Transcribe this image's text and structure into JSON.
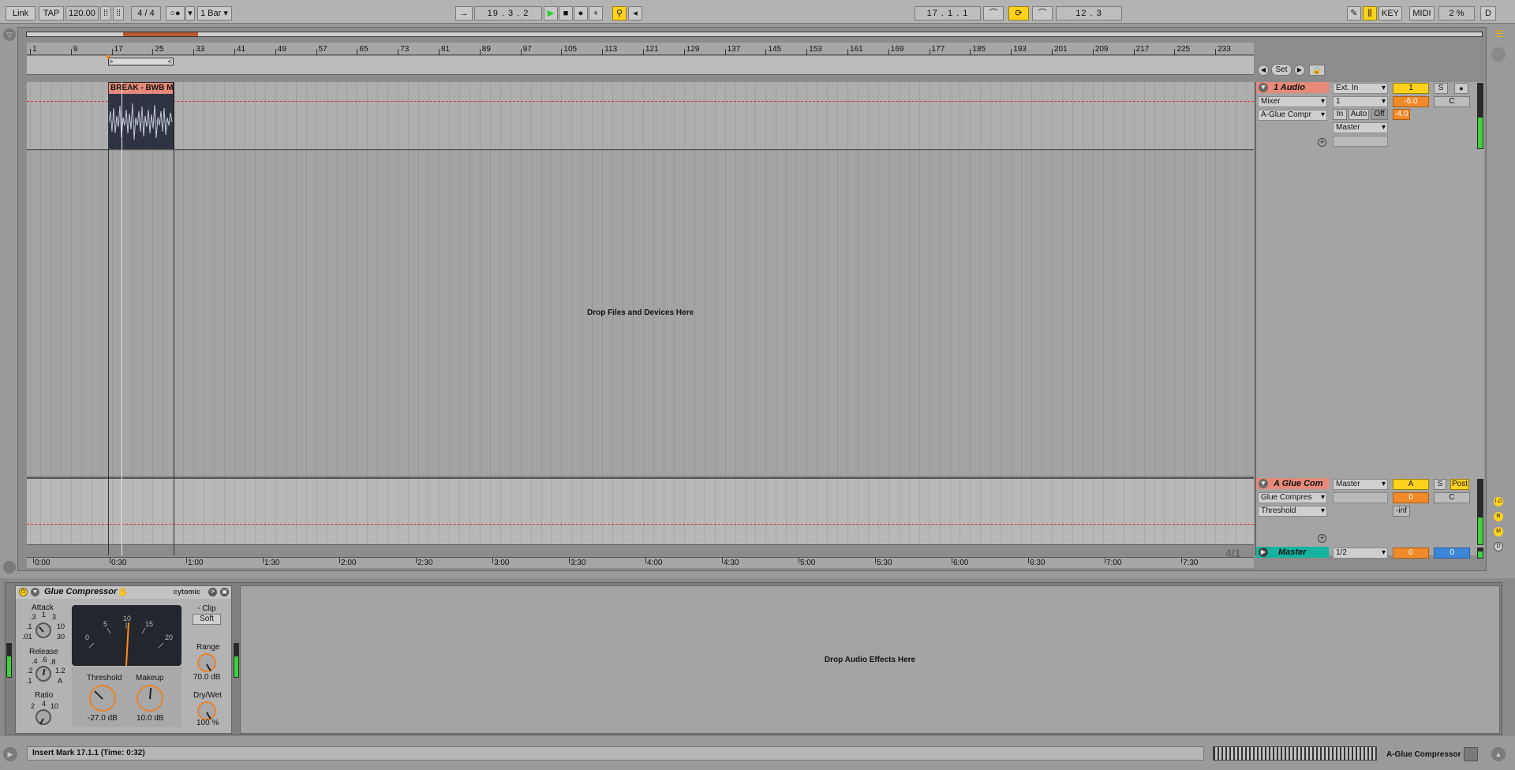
{
  "transport": {
    "link": "Link",
    "tap": "TAP",
    "tempo": "120.00",
    "time_sig": "4 / 4",
    "quantize": "1 Bar",
    "position": [
      "19",
      "3",
      "2"
    ],
    "loop_start": [
      "17",
      "1",
      "1"
    ],
    "loop_length": [
      "12",
      "3",
      ""
    ],
    "key": "KEY",
    "midi": "MIDI",
    "cpu": "2 %",
    "d": "D"
  },
  "ruler": {
    "bars": [
      "1",
      "9",
      "17",
      "25",
      "33",
      "41",
      "49",
      "57",
      "65",
      "73",
      "81",
      "89",
      "97",
      "105",
      "113",
      "121",
      "129",
      "137",
      "145",
      "153",
      "161",
      "169",
      "177",
      "185",
      "193",
      "201",
      "209",
      "217",
      "225",
      "233"
    ],
    "times": [
      "0:00",
      "0:30",
      "1:00",
      "1:30",
      "2:00",
      "2:30",
      "3:00",
      "3:30",
      "4:00",
      "4:30",
      "5:00",
      "5:30",
      "6:00",
      "6:30",
      "7:00",
      "7:30"
    ]
  },
  "locators": {
    "set": "Set"
  },
  "arrangement": {
    "clip_name": "BREAK - BWB MI",
    "drop_files": "Drop Files and Devices Here",
    "time_sig_marker": "4/1"
  },
  "tracks": {
    "audio": {
      "name": "1 Audio",
      "device_chooser": "Mixer",
      "param_chooser": "A-Glue Compr",
      "input_type": "Ext. In",
      "input_channel": "1",
      "monitor": [
        "In",
        "Auto",
        "Off"
      ],
      "output": "Master",
      "number": "1",
      "solo": "S",
      "volume": "-6.0",
      "pan": "C",
      "send": "-4.0"
    },
    "return_a": {
      "name": "A Glue Com",
      "device_chooser": "Glue Compres",
      "param_chooser": "Threshold",
      "output": "Master",
      "letter": "A",
      "solo": "S",
      "post": "Post",
      "volume": "0",
      "pan": "C",
      "send": "-inf"
    },
    "master": {
      "name": "Master",
      "cue_out": "1/2",
      "volume": "0",
      "pan": "0"
    }
  },
  "device": {
    "title": "Glue Compressor",
    "brand": "cytomic",
    "attack_label": "Attack",
    "attack_scale": [
      ".3",
      "1",
      "3",
      ".1",
      "10",
      ".01",
      "30"
    ],
    "release_label": "Release",
    "release_scale": [
      ".4",
      ".6",
      ".8",
      ".2",
      "1.2",
      ".1",
      "A"
    ],
    "ratio_label": "Ratio",
    "ratio_scale": [
      "2",
      "4",
      "10"
    ],
    "meter_scale": [
      "0",
      "5",
      "10",
      "15",
      "20"
    ],
    "clip_label": "Clip",
    "soft": "Soft",
    "threshold_label": "Threshold",
    "threshold_value": "-27.0 dB",
    "makeup_label": "Makeup",
    "makeup_value": "10.0 dB",
    "range_label": "Range",
    "range_value": "70.0 dB",
    "drywet_label": "Dry/Wet",
    "drywet_value": "100 %",
    "drop_effects": "Drop Audio Effects Here"
  },
  "status": {
    "message": "Insert Mark 17.1.1 (Time: 0:32)",
    "selected_device": "A-Glue Compressor"
  },
  "side_letters": [
    "I·O",
    "R",
    "M",
    "D"
  ]
}
